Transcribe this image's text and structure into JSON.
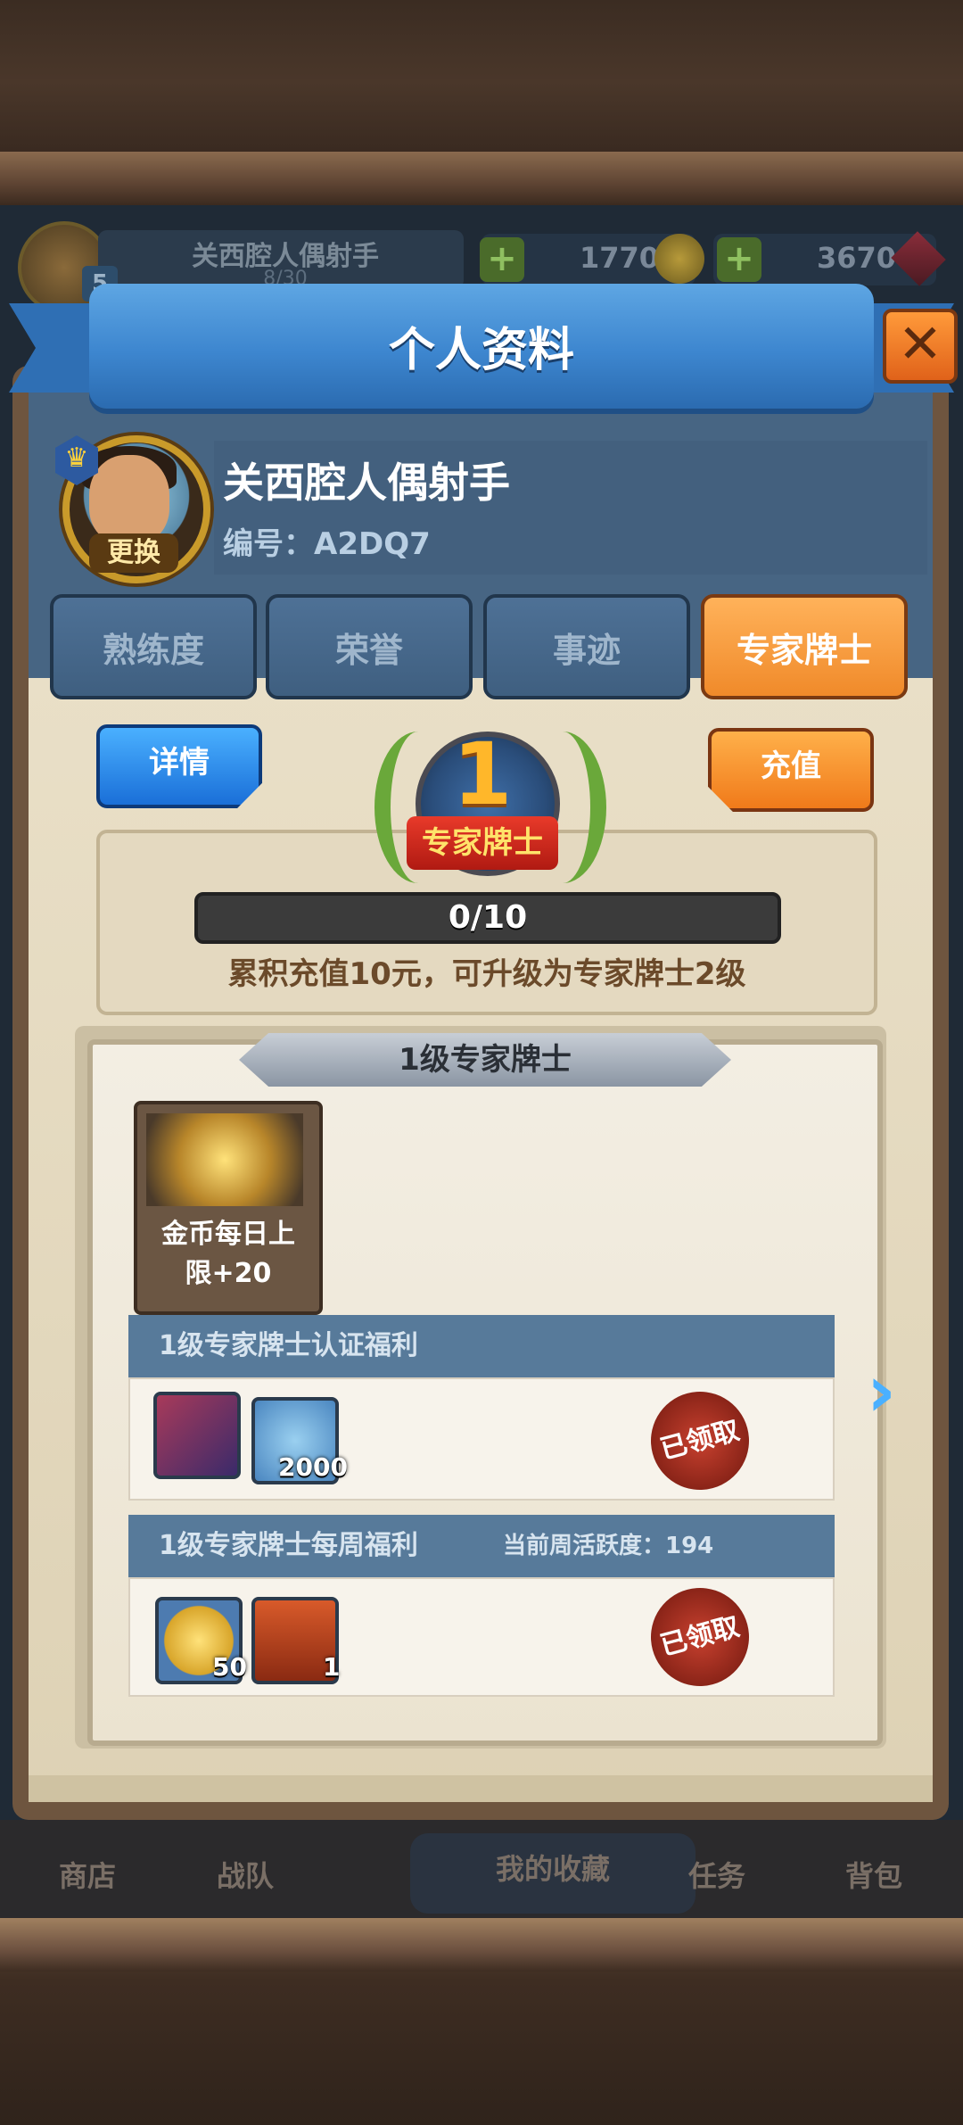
{
  "hud": {
    "player_name": "关西腔人偶射手",
    "exp_text": "8/30",
    "level": "5",
    "gold": "1770",
    "gems": "3670",
    "plus": "+"
  },
  "dialog": {
    "title": "个人资料",
    "close": "✕",
    "profile": {
      "name": "关西腔人偶射手",
      "id_label": "编号：",
      "id_value": "A2DQ7",
      "change_avatar": "更换"
    },
    "tabs": [
      "熟练度",
      "荣誉",
      "事迹",
      "专家牌士"
    ],
    "active_tab": 3,
    "details_button": "详情",
    "recharge_button": "充值",
    "badge": {
      "level": "1",
      "title": "专家牌士"
    },
    "progress": {
      "text": "0/10",
      "fraction": 0.0
    },
    "upgrade_hint": "累积充值10元，可升级为专家牌士2级",
    "scroll": {
      "title": "1级专家牌士",
      "perk_label_1": "金币每日上",
      "perk_label_2": "限+20"
    },
    "cert_section": {
      "title": "1级专家牌士认证福利",
      "items": [
        {
          "icon": "hero-icon",
          "qty": ""
        },
        {
          "icon": "potion-icon",
          "qty": "2000"
        }
      ],
      "status": "已领取"
    },
    "weekly_section": {
      "title": "1级专家牌士每周福利",
      "activity": "当前周活跃度：194",
      "items": [
        {
          "icon": "gold-coin-icon",
          "qty": "50"
        },
        {
          "icon": "chest-icon",
          "qty": "1"
        }
      ],
      "status": "已领取"
    }
  },
  "nav": {
    "shop": "商店",
    "team": "战队",
    "collection": "我的收藏",
    "tasks": "任务",
    "bag": "背包"
  }
}
